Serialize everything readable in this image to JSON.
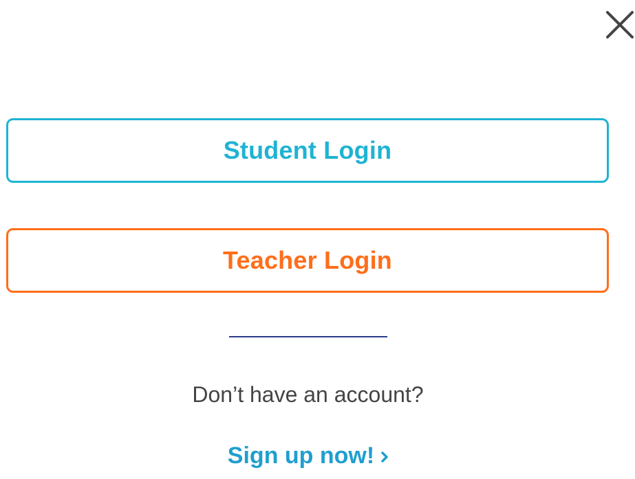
{
  "dialog": {
    "close_icon": "close-icon"
  },
  "buttons": {
    "student_login": "Student Login",
    "teacher_login": "Teacher Login"
  },
  "signup": {
    "prompt": "Don’t have an account?",
    "link_label": "Sign up now!",
    "link_icon": "chevron-right-icon"
  },
  "colors": {
    "student": "#1fb3d3",
    "teacher": "#ff6e1a",
    "divider": "#2a3a86",
    "link": "#1f9fcf",
    "text": "#444444"
  }
}
